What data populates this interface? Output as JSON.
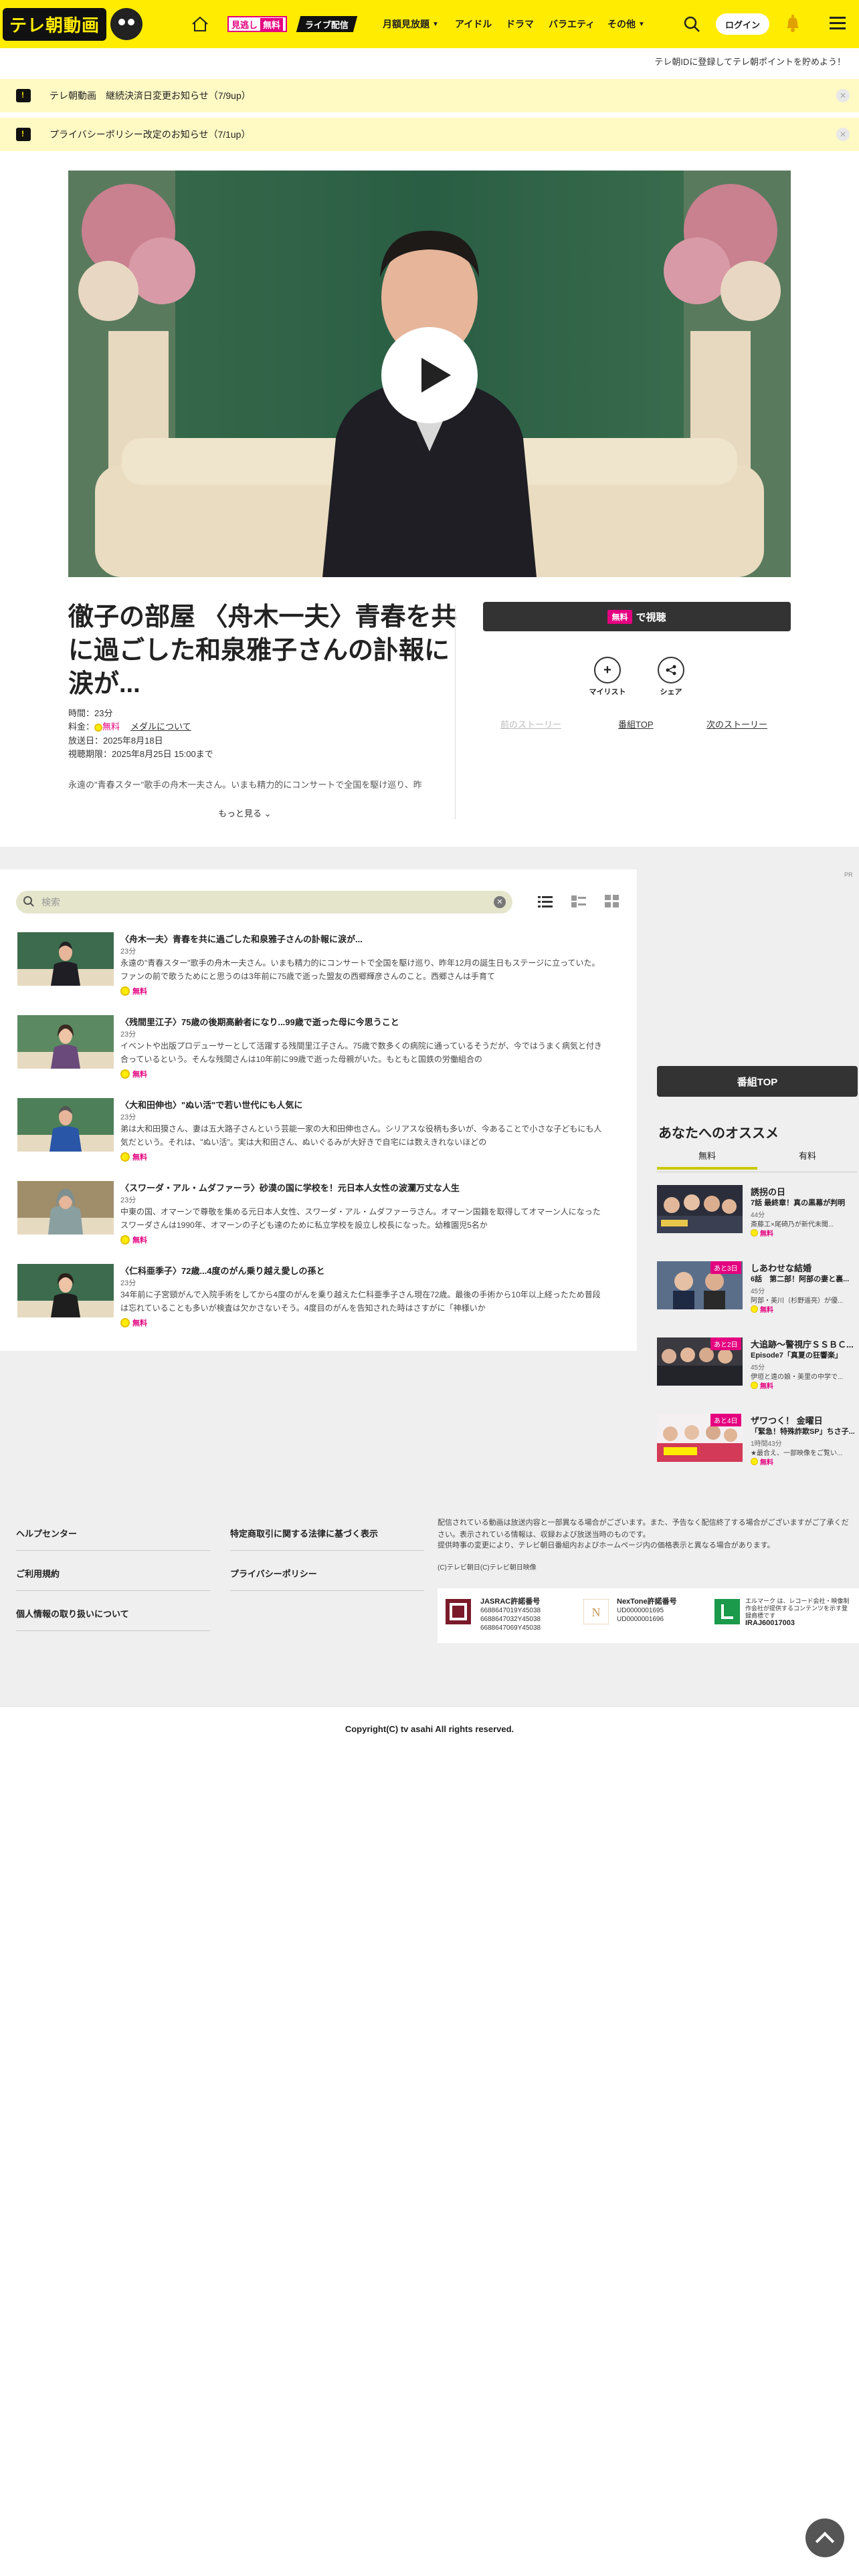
{
  "header": {
    "logo_text": "テレ朝動画",
    "chip_free_label": "見逃し",
    "chip_free_badge": "無料",
    "chip_live_label": "ライブ配信",
    "nav": [
      {
        "label": "月額見放題",
        "has_chevron": true
      },
      {
        "label": "アイドル",
        "has_chevron": false
      },
      {
        "label": "ドラマ",
        "has_chevron": false
      },
      {
        "label": "バラエティ",
        "has_chevron": false
      },
      {
        "label": "その他",
        "has_chevron": true
      }
    ],
    "login_label": "ログイン",
    "icons": {
      "home": "home-icon",
      "search": "search-icon",
      "bell": "bell-icon",
      "menu": "menu-icon"
    }
  },
  "promo_text": "テレ朝IDに登録してテレ朝ポイントを貯めよう！",
  "notices": [
    {
      "text": "テレ朝動画　継続決済日変更お知らせ（7/9up）"
    },
    {
      "text": "プライバシーポリシー改定のお知らせ（7/1up）"
    }
  ],
  "program": {
    "title": "徹子の部屋 〈舟木一夫〉青春を共に過ごした和泉雅子さんの訃報に涙が...",
    "duration": "時間：23分",
    "price_label": "料金：",
    "price_value": "無料",
    "medal_link": "メダルについて",
    "air_date": "放送日：2025年8月18日",
    "deadline": "視聴期限：2025年8月25日 15:00まで",
    "description": "永遠の\"青春スター\"歌手の舟木一夫さん。いまも精力的にコンサートで全国を駆け巡り、昨",
    "more_label": "もっと見る",
    "watch_badge": "無料",
    "watch_label": "で視聴",
    "mylist_label": "マイリスト",
    "share_label": "シェア",
    "prev_story": "前のストーリー",
    "program_top": "番組TOP",
    "next_story": "次のストーリー"
  },
  "ad_label": "PR",
  "episode_list": {
    "search_placeholder": "検索",
    "episodes": [
      {
        "title": "〈舟木一夫〉青春を共に過ごした和泉雅子さんの訃報に涙が...",
        "duration": "23分",
        "description": "永遠の\"青春スター\"歌手の舟木一夫さん。いまも精力的にコンサートで全国を駆け巡り、昨年12月の誕生日もステージに立っていた。ファンの前で歌うためにと思うのは3年前に75歳で逝った盟友の西郷輝彦さんのこと。西郷さんは手育て",
        "free": "無料"
      },
      {
        "title": "〈残間里江子〉75歳の後期高齢者になり...99歳で逝った母に今思うこと",
        "duration": "23分",
        "description": "イベントや出版プロデューサーとして活躍する残間里江子さん。75歳で数多くの病院に通っているそうだが、今ではうまく病気と付き合っているという。そんな残間さんは10年前に99歳で逝った母親がいた。もともと国鉄の労働組合の",
        "free": "無料"
      },
      {
        "title": "〈大和田伸也〉\"ぬい活\"で若い世代にも人気に",
        "duration": "23分",
        "description": "弟は大和田獏さん、妻は五大路子さんという芸能一家の大和田伸也さん。シリアスな役柄も多いが、今あることで小さな子どもにも人気だという。それは、\"ぬい活\"。実は大和田さん、ぬいぐるみが大好きで自宅には数えきれないほどの",
        "free": "無料"
      },
      {
        "title": "〈スワーダ・アル・ムダファーラ〉砂漠の国に学校を！元日本人女性の波瀾万丈な人生",
        "duration": "23分",
        "description": "中東の国、オマーンで尊敬を集める元日本人女性、スワーダ・アル・ムダファーラさん。オマーン国籍を取得してオマーン人になったスワーダさんは1990年、オマーンの子ども達のために私立学校を設立し校長になった。幼稚園児5名か",
        "free": "無料"
      },
      {
        "title": "〈仁科亜季子〉72歳...4度のがん乗り越え愛しの孫と",
        "duration": "23分",
        "description": "34年前に子宮頸がんで入院手術をしてから4度のがんを乗り越えた仁科亜季子さん現在72歳。最後の手術から10年以上経ったため普段は忘れていることも多いが検査は欠かさないそう。4度目のがんを告知された時はさすがに「神様いか",
        "free": "無料"
      }
    ]
  },
  "sidebar": {
    "program_top": "番組TOP",
    "recommend_title": "あなたへのオススメ",
    "tabs": [
      "無料",
      "有料"
    ],
    "items": [
      {
        "pin": "",
        "title": "誘拐の日",
        "subtitle": "7話 最終章！真の黒幕が判明",
        "duration": "44分",
        "desc": "斎藤工×尾碕乃が新代未聞...",
        "free": "無料"
      },
      {
        "pin": "あと3日",
        "title": "しあわせな結婚",
        "subtitle": "6話　第二部！阿部の妻と裏...",
        "duration": "45分",
        "desc": "阿部・美川（杉野遥亮）が優...",
        "free": "無料"
      },
      {
        "pin": "あと2日",
        "title": "大追跡～警視庁ＳＳＢＣ...",
        "subtitle": "Episode7「真夏の狂響楽」",
        "duration": "45分",
        "desc": "伊垣と遠の娘・美里の中学で...",
        "free": "無料"
      },
      {
        "pin": "あと4日",
        "title": "ザワつく！ 金曜日",
        "subtitle": "「緊急！特殊詐欺SP」ちさ子...",
        "duration": "1時間43分",
        "desc": "★最合え、一部映像をご覧い...",
        "free": "無料"
      }
    ]
  },
  "footer": {
    "links_left": [
      "ヘルプセンター",
      "ご利用規約",
      "個人情報の取り扱いについて"
    ],
    "links_right": [
      "特定商取引に関する法律に基づく表示",
      "プライバシーポリシー"
    ],
    "note1": "配信されている動画は放送内容と一部異なる場合がございます。また、予告なく配信終了する場合がございますがご了承ください。表示されている情報は、収録および放送当時のものです。",
    "note2": "提供時事の変更により、テレビ朝日番組内およびホームページ内の価格表示と異なる場合があります。",
    "credit": "(C)テレビ朝日(C)テレビ朝日映像",
    "license": [
      {
        "name": "JASRAC許諾番号",
        "lines": [
          "6688647019Y45038",
          "6688647032Y45038",
          "6688647069Y45038"
        ]
      },
      {
        "name": "NexTone許諾番号",
        "lines": [
          "UD0000001695",
          "UD0000001696"
        ]
      },
      {
        "name": "",
        "lines": [
          "エルマーク は、レコード会社・映像制作会社が提供するコンテンツを示す登録商標です",
          "IRAJ60017003"
        ]
      }
    ],
    "copyright": "Copyright(C) tv asahi All rights reserved."
  },
  "colors": {
    "brand_yellow": "#ffec00",
    "accent_pink": "#e4007f",
    "dark": "#333333"
  }
}
